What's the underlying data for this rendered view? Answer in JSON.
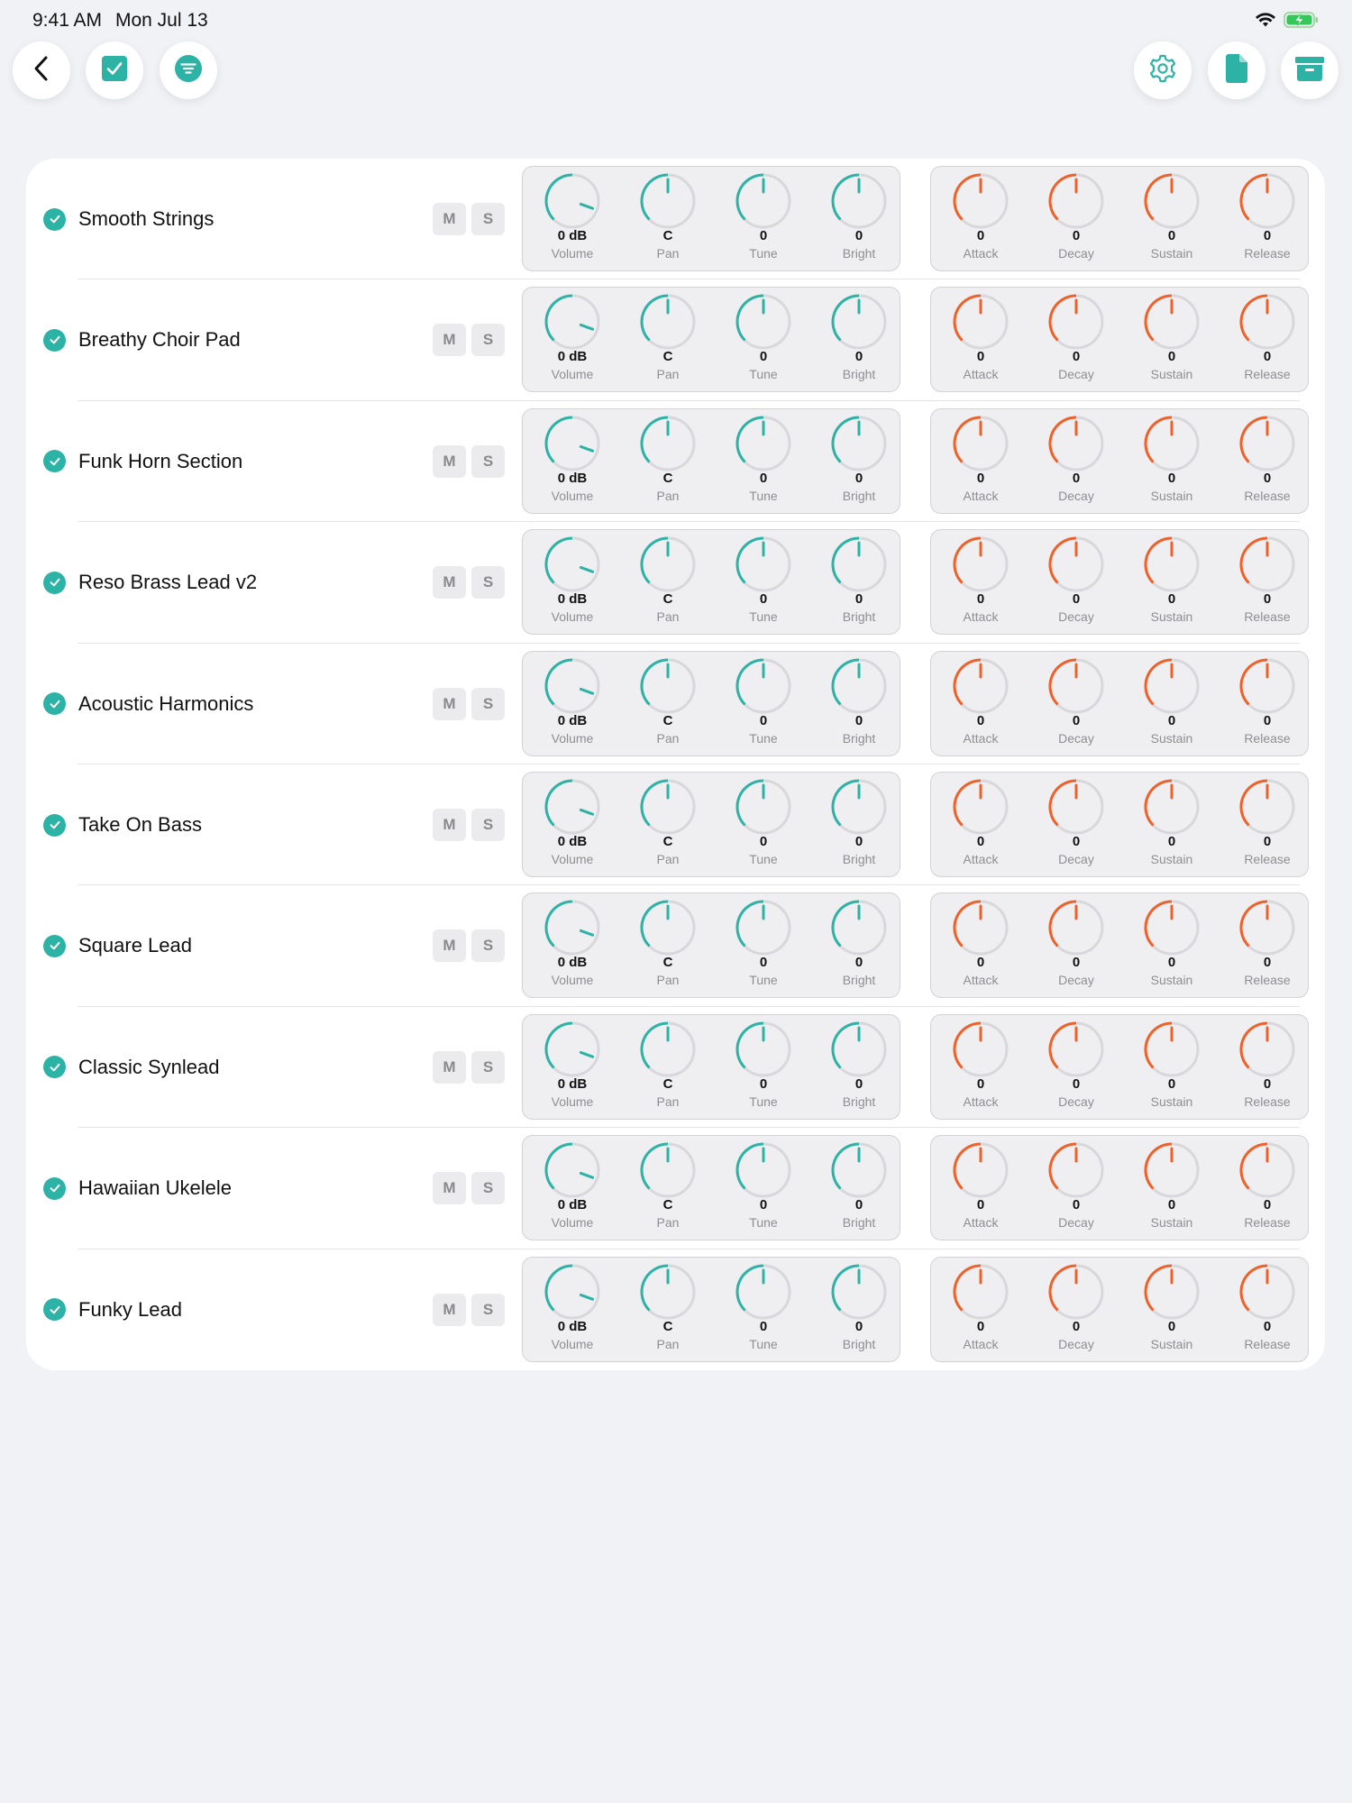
{
  "status_bar": {
    "time": "9:41 AM",
    "date": "Mon Jul 13"
  },
  "toolbar": {
    "left_icons": [
      "back-icon",
      "checkbox-icon",
      "filter-icon"
    ],
    "right_icons": [
      "gear-icon",
      "document-icon",
      "archive-icon"
    ]
  },
  "colors": {
    "accent_teal": "#2db3a5",
    "accent_orange": "#f0612a",
    "knob_track": "#d8d8dc",
    "background": "#f1f2f6"
  },
  "mute_label": "M",
  "solo_label": "S",
  "tracks": [
    {
      "name": "Smooth Strings",
      "enabled": true
    },
    {
      "name": "Breathy Choir Pad",
      "enabled": true
    },
    {
      "name": "Funk Horn Section",
      "enabled": true
    },
    {
      "name": "Reso Brass Lead v2",
      "enabled": true
    },
    {
      "name": "Acoustic Harmonics",
      "enabled": true
    },
    {
      "name": "Take On Bass",
      "enabled": true
    },
    {
      "name": "Square Lead",
      "enabled": true
    },
    {
      "name": "Classic Synlead",
      "enabled": true
    },
    {
      "name": "Hawaiian Ukelele",
      "enabled": true
    },
    {
      "name": "Funky Lead",
      "enabled": true
    }
  ],
  "mix_knobs": [
    {
      "label": "Volume",
      "value": "0 dB",
      "level": 0.5
    },
    {
      "label": "Pan",
      "value": "C",
      "level": 0.5
    },
    {
      "label": "Tune",
      "value": "0",
      "level": 0.5
    },
    {
      "label": "Bright",
      "value": "0",
      "level": 0.5
    }
  ],
  "envelope_knobs": [
    {
      "label": "Attack",
      "value": "0",
      "level": 0.5
    },
    {
      "label": "Decay",
      "value": "0",
      "level": 0.5
    },
    {
      "label": "Sustain",
      "value": "0",
      "level": 0.5
    },
    {
      "label": "Release",
      "value": "0",
      "level": 0.5
    }
  ]
}
